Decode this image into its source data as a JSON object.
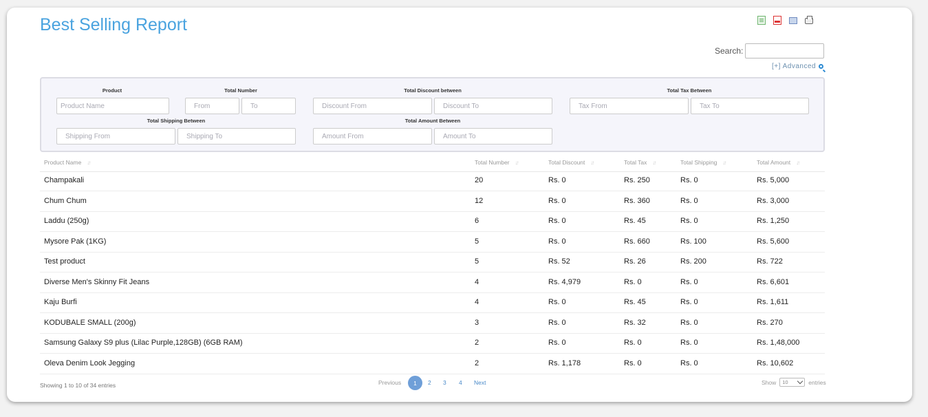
{
  "page": {
    "title": "Best Selling Report"
  },
  "export": {
    "icons": [
      "csv-icon",
      "pdf-icon",
      "excel-icon",
      "print-icon"
    ]
  },
  "search": {
    "label": "Search:",
    "value": ""
  },
  "advanced": {
    "label": "[+] Advanced"
  },
  "filters": {
    "product_label": "Product",
    "product_placeholder": "Product Name",
    "total_number_label": "Total Number",
    "from_placeholder": "From",
    "to_placeholder": "To",
    "discount_label": "Total Discount between",
    "discount_from": "Discount From",
    "discount_to": "Discount To",
    "tax_label": "Total Tax Between",
    "tax_from": "Tax From",
    "tax_to": "Tax To",
    "shipping_label": "Total Shipping Between",
    "shipping_from": "Shipping From",
    "shipping_to": "Shipping To",
    "amount_label": "Total Amount Between",
    "amount_from": "Amount From",
    "amount_to": "Amount To"
  },
  "table": {
    "headers": [
      "Product Name",
      "Total Number",
      "Total Discount",
      "Total Tax",
      "Total Shipping",
      "Total Amount"
    ],
    "rows": [
      [
        "Champakali",
        "20",
        "Rs. 0",
        "Rs. 250",
        "Rs. 0",
        "Rs. 5,000"
      ],
      [
        "Chum Chum",
        "12",
        "Rs. 0",
        "Rs. 360",
        "Rs. 0",
        "Rs. 3,000"
      ],
      [
        "Laddu (250g)",
        "6",
        "Rs. 0",
        "Rs. 45",
        "Rs. 0",
        "Rs. 1,250"
      ],
      [
        "Mysore Pak (1KG)",
        "5",
        "Rs. 0",
        "Rs. 660",
        "Rs. 100",
        "Rs. 5,600"
      ],
      [
        "Test product",
        "5",
        "Rs. 52",
        "Rs. 26",
        "Rs. 200",
        "Rs. 722"
      ],
      [
        "Diverse Men's Skinny Fit Jeans",
        "4",
        "Rs. 4,979",
        "Rs. 0",
        "Rs. 0",
        "Rs. 6,601"
      ],
      [
        "Kaju Burfi",
        "4",
        "Rs. 0",
        "Rs. 45",
        "Rs. 0",
        "Rs. 1,611"
      ],
      [
        "KODUBALE SMALL (200g)",
        "3",
        "Rs. 0",
        "Rs. 32",
        "Rs. 0",
        "Rs. 270"
      ],
      [
        "Samsung Galaxy S9 plus (Lilac Purple,128GB) (6GB RAM)",
        "2",
        "Rs. 0",
        "Rs. 0",
        "Rs. 0",
        "Rs. 1,48,000"
      ],
      [
        "Oleva Denim Look Jegging",
        "2",
        "Rs. 1,178",
        "Rs. 0",
        "Rs. 0",
        "Rs. 10,602"
      ]
    ]
  },
  "footer": {
    "info": "Showing 1 to 10 of 34 entries",
    "previous": "Previous",
    "pages": [
      "1",
      "2",
      "3",
      "4"
    ],
    "next": "Next",
    "show_label": "Show",
    "page_size": "10",
    "entries_label": "entries"
  }
}
